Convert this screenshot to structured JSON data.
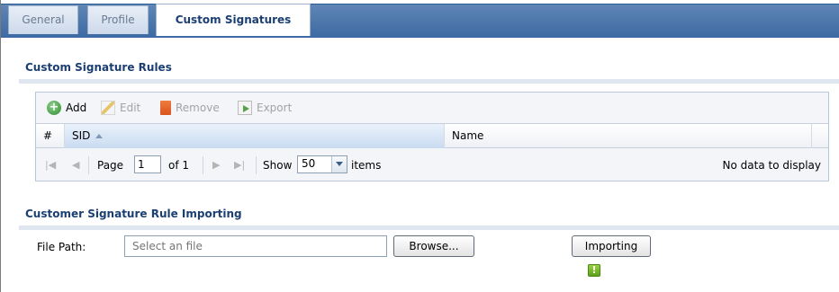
{
  "tabs": [
    {
      "label": "General",
      "active": false
    },
    {
      "label": "Profile",
      "active": false
    },
    {
      "label": "Custom Signatures",
      "active": true
    }
  ],
  "rules_section": {
    "title": "Custom Signature Rules",
    "toolbar": {
      "add": "Add",
      "edit": "Edit",
      "remove": "Remove",
      "export": "Export"
    },
    "columns": {
      "hash": "#",
      "sid": "SID",
      "name": "Name"
    },
    "pager": {
      "page_label": "Page",
      "page_value": "1",
      "of_label": "of 1",
      "show_label": "Show",
      "show_value": "50",
      "items_label": "items",
      "empty_text": "No data to display"
    }
  },
  "import_section": {
    "title": "Customer Signature Rule Importing",
    "file_path_label": "File Path:",
    "file_placeholder": "Select an file",
    "browse_label": "Browse...",
    "importing_label": "Importing",
    "status_icon_glyph": "!"
  },
  "colors": {
    "tab_bar": "#3d6aa3",
    "section_title": "#1b3f73",
    "status_icon": "#5e9f1a"
  }
}
